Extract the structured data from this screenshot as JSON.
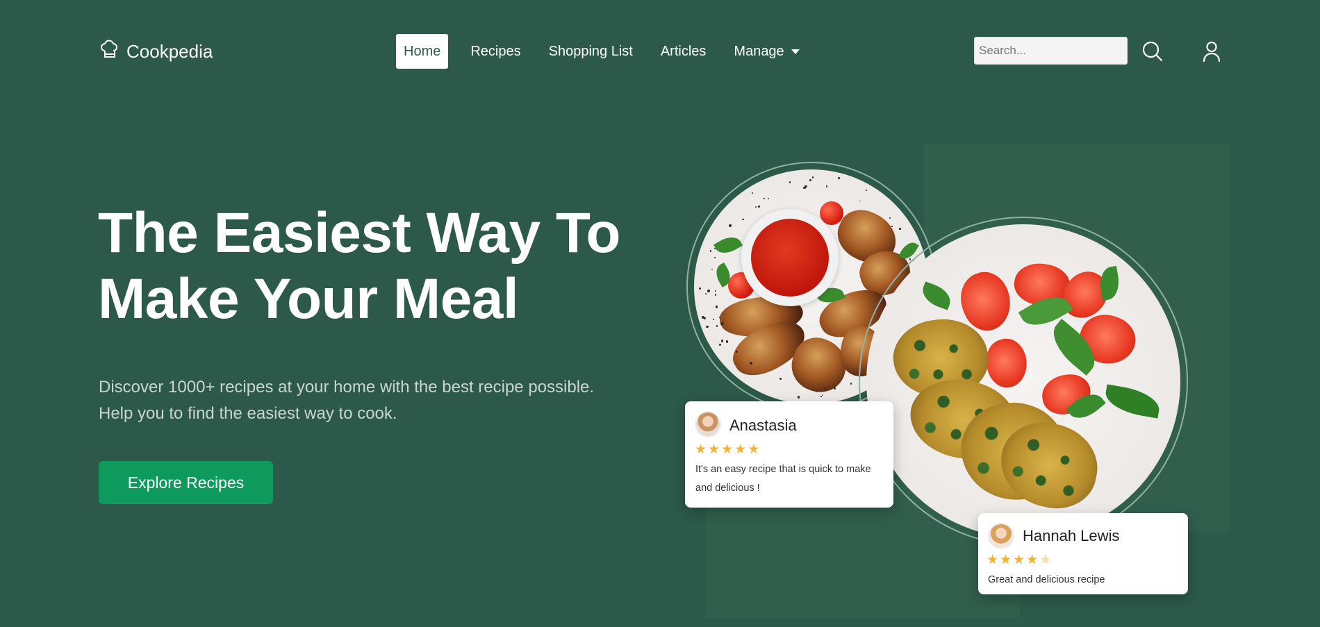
{
  "brand": {
    "name": "Cookpedia",
    "icon": "chef-hat-icon"
  },
  "nav": {
    "items": [
      {
        "label": "Home",
        "active": true
      },
      {
        "label": "Recipes"
      },
      {
        "label": "Shopping List"
      },
      {
        "label": "Articles"
      },
      {
        "label": "Manage",
        "dropdown": true
      }
    ]
  },
  "search": {
    "placeholder": "Search...",
    "value": ""
  },
  "header_icons": {
    "search": "search-icon",
    "user": "user-icon"
  },
  "hero": {
    "title_line1": "The Easiest Way To",
    "title_line2": "Make Your Meal",
    "desc_line1": "Discover 1000+ recipes at your home with the best recipe possible.",
    "desc_line2": "Help you to find the easiest way to cook.",
    "cta": "Explore Recipes"
  },
  "reviews": [
    {
      "name": "Anastasia",
      "rating": 5,
      "text": "It's an easy recipe that is quick to make and delicious !"
    },
    {
      "name": "Hannah Lewis",
      "rating": 4.5,
      "text": "Great and delicious recipe"
    }
  ],
  "colors": {
    "background": "#2c5949",
    "cta": "#0d9a5c",
    "star": "#f2b233"
  }
}
